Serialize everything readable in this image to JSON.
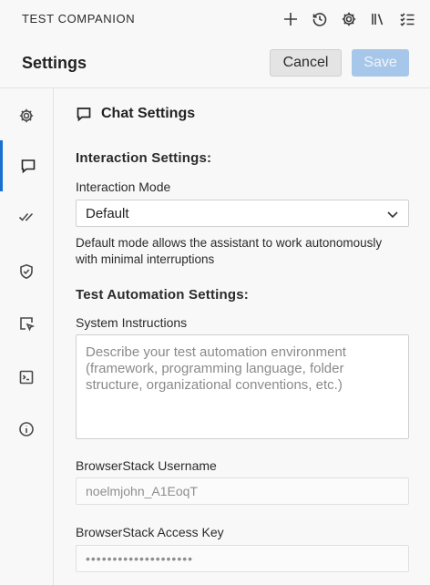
{
  "app": {
    "title": "TEST COMPANION"
  },
  "toolbar": {
    "icons": [
      "plus-icon",
      "history-icon",
      "gear-icon",
      "library-icon",
      "checklist-icon"
    ]
  },
  "header": {
    "title": "Settings",
    "cancel_label": "Cancel",
    "save_label": "Save"
  },
  "sidebar": {
    "items": [
      {
        "icon": "gear-icon",
        "active": false
      },
      {
        "icon": "chat-icon",
        "active": true
      },
      {
        "icon": "double-check-icon",
        "active": false
      },
      {
        "icon": "shield-check-icon",
        "active": false
      },
      {
        "icon": "select-pointer-icon",
        "active": false
      },
      {
        "icon": "terminal-icon",
        "active": false
      },
      {
        "icon": "info-icon",
        "active": false
      }
    ]
  },
  "main": {
    "section_title": "Chat Settings",
    "interaction_heading": "Interaction Settings:",
    "interaction_mode_label": "Interaction Mode",
    "interaction_mode_value": "Default",
    "interaction_help": "Default mode allows the assistant to work autonomously with minimal interruptions",
    "automation_heading": "Test Automation Settings:",
    "system_instructions_label": "System Instructions",
    "system_instructions_placeholder": "Describe your test automation environment (framework, programming language, folder structure, organizational conventions, etc.)",
    "username_label": "BrowserStack Username",
    "username_value": "noelmjohn_A1EoqT",
    "access_key_label": "BrowserStack Access Key",
    "access_key_value": "••••••••••••••••••••"
  },
  "colors": {
    "accent": "#1a6fd1",
    "save_button": "#a7c7ea"
  }
}
